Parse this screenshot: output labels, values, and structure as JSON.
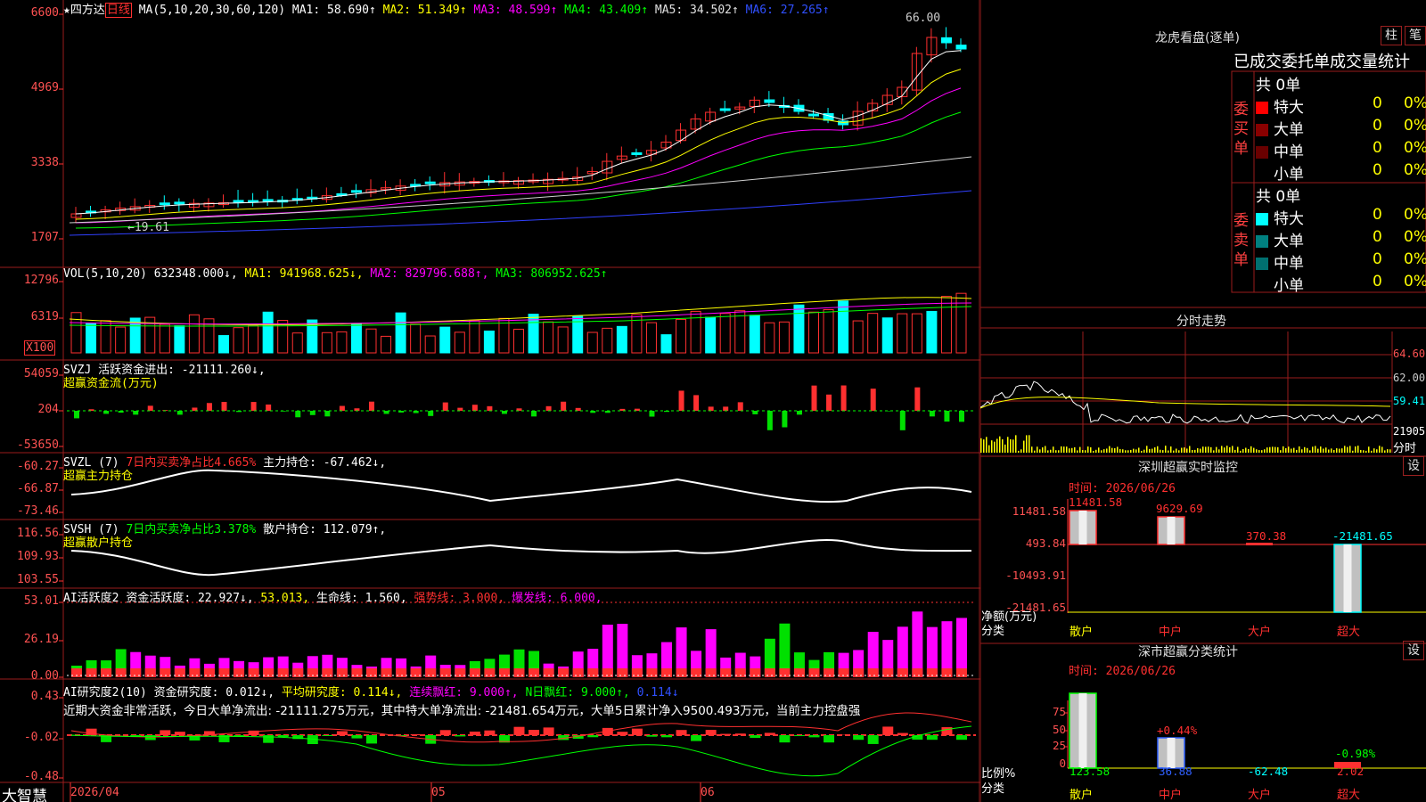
{
  "colors": {
    "up": "#ff3030",
    "down": "#00ffff",
    "green": "#00e000",
    "magenta": "#ff00ff",
    "yellow": "#ffff00",
    "grid": "#9a1c1c"
  },
  "header": {
    "star": "★",
    "stock_name": "四方达",
    "period": "日线",
    "ma_prefix": "MA(5,10,20,30,60,120)",
    "ma1": "MA1: 58.690↑",
    "ma2": "MA2: 51.349↑",
    "ma3": "MA3: 48.599↑",
    "ma4": "MA4: 43.409↑",
    "ma5": "MA5: 34.502↑",
    "ma6": "MA6: 27.265↑"
  },
  "price_panel": {
    "y_labels": [
      "6600",
      "4969",
      "3338",
      "1707"
    ],
    "high_marker": "66.00",
    "low_marker": "19.61"
  },
  "vol_panel": {
    "header": [
      "VOL(5,10,20)",
      "632348.000↓,",
      "MA1: 941968.625↓,",
      "MA2: 829796.688↑,",
      "MA3: 806952.625↑"
    ],
    "y_labels": [
      "12796",
      "6319"
    ],
    "unit": "X100"
  },
  "svzj_panel": {
    "header": [
      "SVZJ",
      "活跃资金进出: -21111.260↓,"
    ],
    "sub": "超赢资金流(万元)",
    "y_labels": [
      "54059",
      "204",
      "-53650"
    ]
  },
  "svzl_panel": {
    "header": [
      "SVZL (7)",
      "7日内买卖净占比4.665%",
      "主力持仓: -67.462↓,"
    ],
    "sub": "超赢主力持仓",
    "y_labels": [
      "-60.27",
      "-66.87",
      "-73.46"
    ]
  },
  "svsh_panel": {
    "header": [
      "SVSH (7)",
      "7日内买卖净占比3.378%",
      "散户持仓: 112.079↑,"
    ],
    "sub": "超赢散户持仓",
    "y_labels": [
      "116.56",
      "109.93",
      "103.55"
    ]
  },
  "ai2_panel": {
    "header": [
      "AI活跃度2",
      "资金活跃度: 22.927↓,",
      "53.013,",
      "生命线: 1.560,",
      "强势线: 3.000,",
      "爆发线: 6.000,"
    ],
    "y_labels": [
      "53.01",
      "26.19",
      "0.00"
    ]
  },
  "ai_research_panel": {
    "header": [
      "AI研究度2(10)",
      "资金研究度: 0.012↓,",
      "平均研究度: 0.114↓,",
      "连续飘红: 9.000↑,",
      "N日飘红: 9.000↑,",
      "0.114↓"
    ],
    "comment": "近期大资金非常活跃，今日大单净流出: -21111.275万元，其中特大单净流出: -21481.654万元，大单5日累计净入9500.493万元，当前主力控盘强",
    "y_labels": [
      "0.43",
      "-0.02",
      "-0.48"
    ]
  },
  "footer": {
    "brand": "大智慧",
    "date_start": "2026/04",
    "month_05": "05",
    "month_06": "06"
  },
  "dragon_tiger": {
    "title": "龙虎看盘(逐单)",
    "btn_bar": "柱",
    "btn_detail": "笔",
    "subtitle": "已成交委托单成交量统计",
    "buy_side_label": "委买单",
    "sell_side_label": "委卖单",
    "buy_total": "共 0单",
    "sell_total": "共 0单",
    "buy_rows": [
      {
        "label": "特大",
        "count": "0",
        "pct": "0%"
      },
      {
        "label": "大单",
        "count": "0",
        "pct": "0%"
      },
      {
        "label": "中单",
        "count": "0",
        "pct": "0%"
      },
      {
        "label": "小单",
        "count": "0",
        "pct": "0%"
      }
    ],
    "sell_rows": [
      {
        "label": "特大",
        "count": "0",
        "pct": "0%"
      },
      {
        "label": "大单",
        "count": "0",
        "pct": "0%"
      },
      {
        "label": "中单",
        "count": "0",
        "pct": "0%"
      },
      {
        "label": "小单",
        "count": "0",
        "pct": "0%"
      }
    ]
  },
  "intraday": {
    "title": "分时走势",
    "y_labels": [
      "64.60",
      "62.00",
      "59.41",
      "21905"
    ],
    "unit": "分时"
  },
  "sz_monitor": {
    "title": "深圳超赢实时监控",
    "btn": "设",
    "time_label": "时间: 2026/06/26",
    "y_labels": [
      "11481.58",
      "493.84",
      "-10493.91",
      "-21481.65"
    ],
    "axis_title_1": "净额(万元)",
    "axis_title_2": "分类",
    "bars": [
      {
        "cat": "散户",
        "value": 11481.58,
        "label": "11481.58"
      },
      {
        "cat": "中户",
        "value": 9629.69,
        "label": "9629.69"
      },
      {
        "cat": "大户",
        "value": 370.38,
        "label": "370.38"
      },
      {
        "cat": "超大",
        "value": -21481.65,
        "label": "-21481.65"
      }
    ]
  },
  "sz_class": {
    "title": "深市超赢分类统计",
    "btn": "设",
    "time_label": "时间: 2026/06/26",
    "y_labels": [
      "75",
      "50",
      "25",
      "0"
    ],
    "axis_title_1": "比例%",
    "axis_title_2": "分类",
    "bars": [
      {
        "cat": "散户",
        "value": 123.58,
        "pct_label": "",
        "value_label": "123.58"
      },
      {
        "cat": "中户",
        "value": 36.88,
        "pct_label": "+0.44%",
        "value_label": "36.88"
      },
      {
        "cat": "大户",
        "value": -62.48,
        "pct_label": "",
        "value_label": "-62.48"
      },
      {
        "cat": "超大",
        "value": 2.02,
        "pct_label": "-0.98%",
        "value_label": "2.02"
      }
    ]
  }
}
